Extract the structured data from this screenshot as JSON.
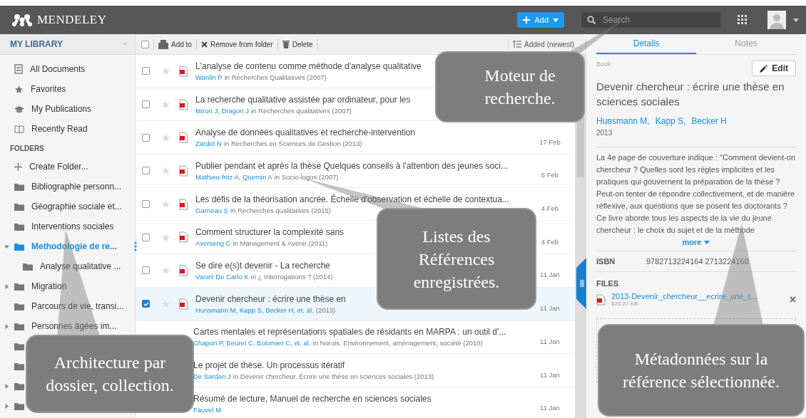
{
  "header": {
    "logo": "MENDELEY",
    "add_button": "Add",
    "search": {
      "placeholder": "Search"
    }
  },
  "sidebar": {
    "title": "MY LIBRARY",
    "library_items": [
      {
        "label": "All Documents",
        "selected": false
      },
      {
        "label": "Favorites",
        "selected": false
      },
      {
        "label": "My Publications",
        "selected": false
      },
      {
        "label": "Recently Read",
        "selected": false
      }
    ],
    "folders_heading": "FOLDERS",
    "create_folder": "Create Folder...",
    "folders": [
      {
        "label": "Bibliographie personn...",
        "selected": false
      },
      {
        "label": "Géographie sociale et...",
        "selected": false
      },
      {
        "label": "Interventions sociales",
        "selected": false
      },
      {
        "label": "Methodologie de re...",
        "selected": true,
        "expanded": true,
        "children": [
          {
            "label": "Analyse qualitative ...",
            "selected": false
          }
        ]
      },
      {
        "label": "Migration",
        "selected": false,
        "expanded": false
      },
      {
        "label": "Parcours de vie, transi...",
        "selected": false
      },
      {
        "label": "Personnes âgées im...",
        "selected": false,
        "expanded": false
      },
      {
        "selected": false
      },
      {
        "selected": false
      },
      {
        "selected": false,
        "expanded": false
      },
      {
        "selected": false,
        "expanded": false
      }
    ]
  },
  "toolbar": {
    "select_all_checked": false,
    "add_to": "Add to",
    "remove": "Remove from folder",
    "delete": "Delete",
    "sort": "Added (newest)"
  },
  "documents": [
    {
      "title": "L'analyse de contenu comme méthode d'analyse qualitative",
      "authors": "Wanlin P",
      "source": "in Recherches Qualitatives (2007)",
      "checked": false
    },
    {
      "title": "La recherche qualitative assistée par ordinateur, pour les",
      "authors": "Miron J, Dragon J",
      "source": "in Recherches qualitatives (2007)",
      "checked": false
    },
    {
      "title": "Analyse de données qualitatives et recherche-intervention",
      "authors": "Zardet N",
      "source": "in Recherches en Sciences de Gestion (2013)",
      "date": "17 Feb",
      "checked": false
    },
    {
      "title": "Publier pendant et après la thèse Quelques conseils à l'attention des jeunes soci...",
      "authors": "Mathieu-fritz A, Quemin A",
      "source": "in Socio-logos (2007)",
      "date": "5 Feb",
      "checked": false
    },
    {
      "title": "Les défis de la théorisation ancrée. Échelle d'observation et échelle de contextua...",
      "authors": "Garneau S",
      "source": "in Recherches qualitatives (2015)",
      "date": "4 Feb",
      "checked": false
    },
    {
      "title": "Comment structurer la complexité sans",
      "authors": "Averseng C",
      "source": "in Management & Avenir (2011)",
      "date": "4 Feb",
      "checked": false
    },
    {
      "title": "Se dire e(s)t devenir - La recherche",
      "authors": "Vanini De Carlo K",
      "source": "in ¿ Interrogations ? (2014)",
      "date": "11 Jan",
      "checked": false
    },
    {
      "title": "Devenir chercheur : écrire une thèse en",
      "authors": "Hunsmann M, Kapp S, Becker H, et. al.",
      "source": "(2013)",
      "date": "11 Jan",
      "checked": true
    },
    {
      "title": "Cartes mentales et représentations spatiales de résidants en MARPA : un outil d'...",
      "authors": "Chapon P, Beuret C, Bolomier C, et. al.",
      "source": "in Norois. Environnement, aménagement, société (2010)",
      "date": "11 Jan"
    },
    {
      "title": "Le projet de thèse. Un processus itératif",
      "authors": "De Sardan J",
      "source": "in Devenir chercheur. Écrire une thèse en sciences sociales (2013)",
      "date": "11 Jan"
    },
    {
      "title": "Résumé de lecture, Manuel de recherche en sciences sociales",
      "authors": "Fauvel M",
      "date": "11 Jan"
    }
  ],
  "details": {
    "tabs": [
      {
        "label": "Details",
        "selected": true
      },
      {
        "label": "Notes",
        "selected": false
      }
    ],
    "type": "Book",
    "edit": "Edit",
    "title": "Devenir chercheur : écrire une thèse en sciences sociales",
    "authors": [
      "Hunsmann M,",
      "Kapp S,",
      "Becker H"
    ],
    "year": "2013",
    "abstract": "La 4e page de couverture indique : \"Comment devient-on chercheur ? Quelles sont les règles implicites et les pratiques qui gouvernent la préparation de la thèse ? Peut-on tenter de répondre collectivement, et de manière réflexive, aux questions que se posent les doctorants ? Ce livre aborde tous les aspects de la vie du jeune chercheur : le choix du sujet et de la méthode",
    "more": "more",
    "isbn_label": "ISBN",
    "isbn": "9782713224164 2713224160",
    "files_heading": "FILES",
    "file": {
      "name": "2013-Devenir_chercheur__ecrire_une_t...",
      "size": "620.27 KB"
    }
  },
  "callouts": [
    {
      "text": "Moteur de recherche."
    },
    {
      "text": "Listes des Références enregistrées."
    },
    {
      "text": "Architecture par dossier, collection."
    },
    {
      "text": "Métadonnées sur la référence sélectionnée."
    }
  ]
}
